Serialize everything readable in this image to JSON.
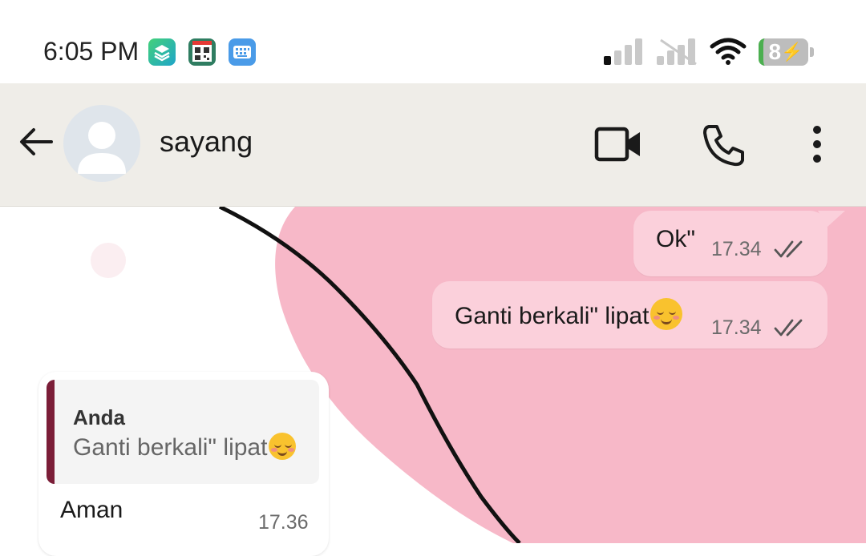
{
  "status_bar": {
    "time": "6:05 PM",
    "notification_icons": [
      "layers-app-icon",
      "qr-scanner-app-icon",
      "keyboard-app-icon"
    ],
    "battery_level": "8",
    "icons": [
      "signal-bars-icon",
      "no-signal-sim2-icon",
      "wifi-icon",
      "battery-charging-icon"
    ]
  },
  "header": {
    "contact_name": "sayang",
    "actions": [
      "video-call-icon",
      "voice-call-icon",
      "more-options-icon"
    ]
  },
  "messages": [
    {
      "direction": "outgoing",
      "text": "Ok\"",
      "time": "17.34",
      "status": "read-double-check"
    },
    {
      "direction": "outgoing",
      "text": "Ganti berkali\" lipat",
      "emoji": "smiling-face-with-blush",
      "time": "17.34",
      "status": "read-double-check"
    },
    {
      "direction": "incoming",
      "reply_to": {
        "author": "Anda",
        "text": "Ganti berkali\" lipat",
        "emoji": "smiling-face-with-blush"
      },
      "text": "Aman",
      "time": "17.36"
    }
  ],
  "theme": {
    "header_bg": "#efede8",
    "outgoing_bubble": "#fbd0db",
    "wallpaper_blob": "#f7b8c8",
    "quote_bar": "#7b1e38"
  }
}
